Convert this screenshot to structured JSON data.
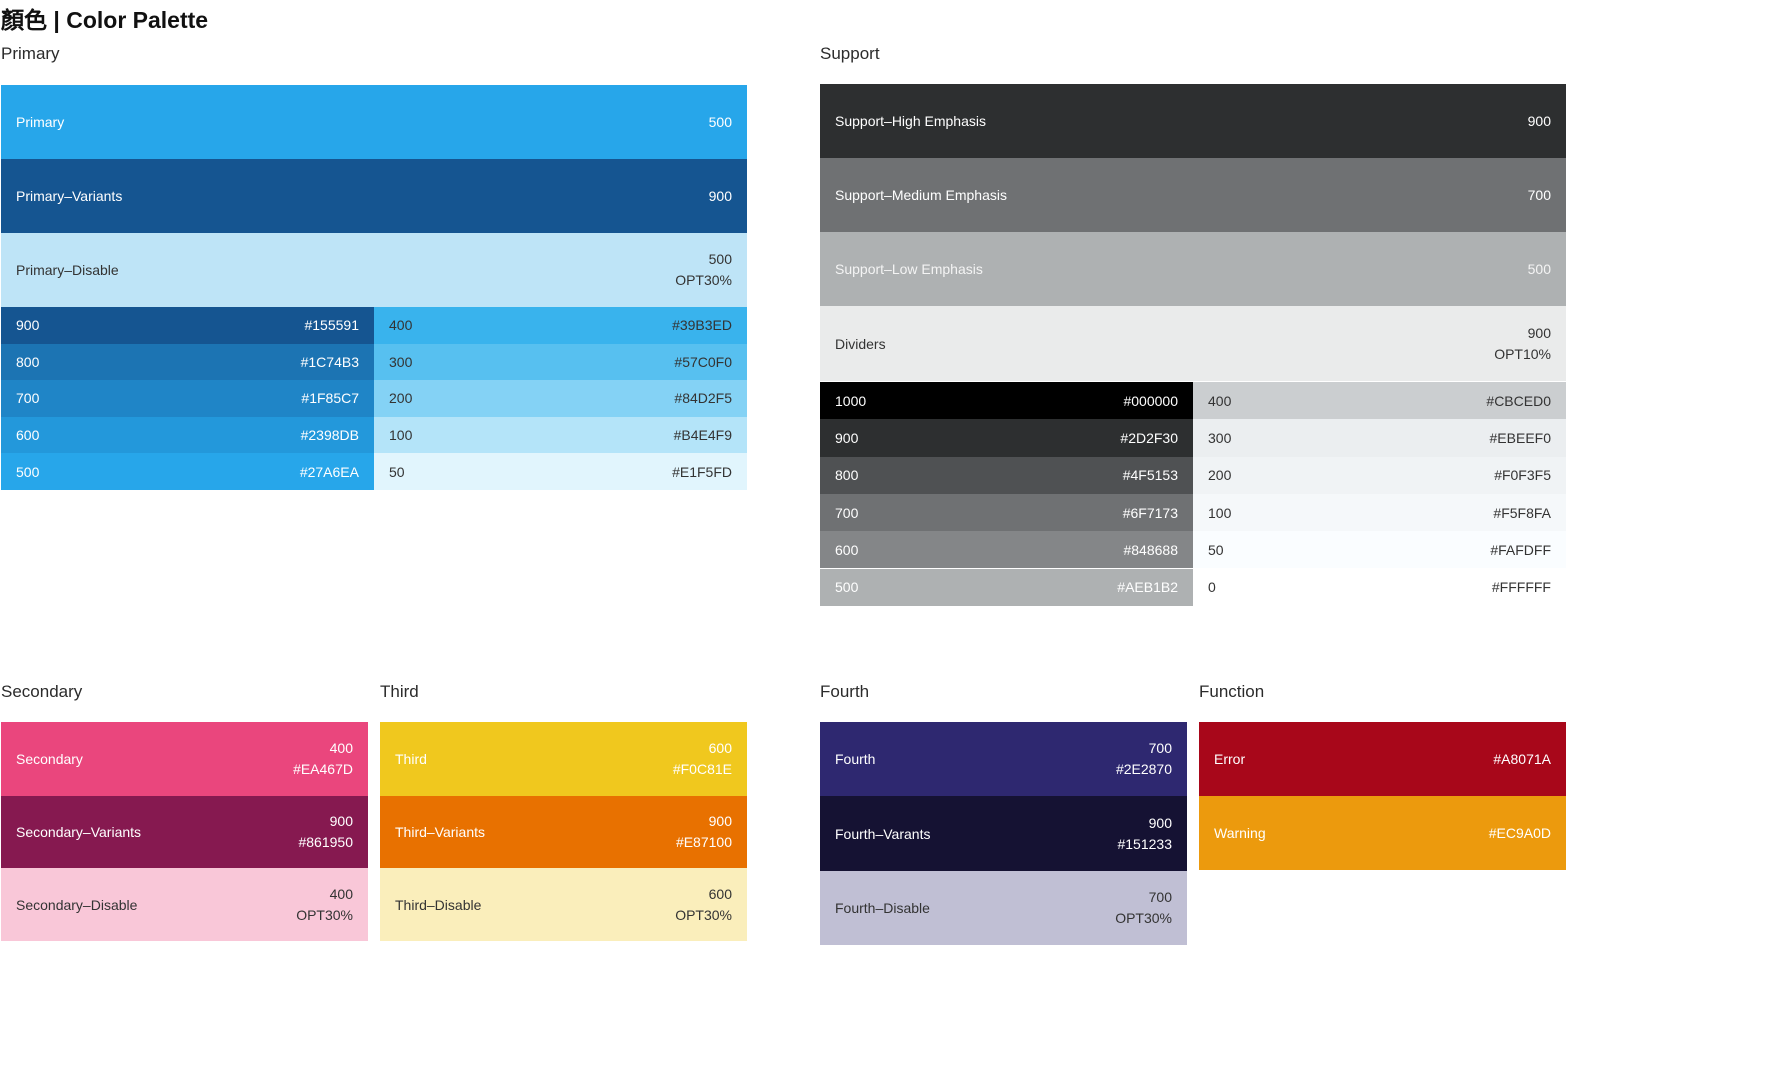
{
  "title": "顏色 | Color Palette",
  "primary": {
    "heading": "Primary",
    "big": [
      {
        "name": "Primary",
        "v1": "500",
        "v2": "",
        "color": "#27A6EA",
        "text": "#ffffff"
      },
      {
        "name": "Primary–Variants",
        "v1": "900",
        "v2": "",
        "color": "#155591",
        "text": "#ffffff"
      },
      {
        "name": "Primary–Disable",
        "v1": "500",
        "v2": "OPT30%",
        "color": "#BEE4F7",
        "text": "#333333"
      }
    ],
    "left": [
      {
        "level": "900",
        "hex": "#155591",
        "color": "#155591",
        "text": "#ffffff"
      },
      {
        "level": "800",
        "hex": "#1C74B3",
        "color": "#1C74B3",
        "text": "#ffffff"
      },
      {
        "level": "700",
        "hex": "#1F85C7",
        "color": "#1F85C7",
        "text": "#ffffff"
      },
      {
        "level": "600",
        "hex": "#2398DB",
        "color": "#2398DB",
        "text": "#ffffff"
      },
      {
        "level": "500",
        "hex": "#27A6EA",
        "color": "#27A6EA",
        "text": "#ffffff"
      }
    ],
    "right": [
      {
        "level": "400",
        "hex": "#39B3ED",
        "color": "#39B3ED",
        "text": "#333333"
      },
      {
        "level": "300",
        "hex": "#57C0F0",
        "color": "#57C0F0",
        "text": "#333333"
      },
      {
        "level": "200",
        "hex": "#84D2F5",
        "color": "#84D2F5",
        "text": "#333333"
      },
      {
        "level": "100",
        "hex": "#B4E4F9",
        "color": "#B4E4F9",
        "text": "#333333"
      },
      {
        "level": "50",
        "hex": "#E1F5FD",
        "color": "#E1F5FD",
        "text": "#333333"
      }
    ]
  },
  "support": {
    "heading": "Support",
    "big": [
      {
        "name": "Support–High Emphasis",
        "v1": "900",
        "v2": "",
        "color": "#2D2F30",
        "text": "#ffffff"
      },
      {
        "name": "Support–Medium Emphasis",
        "v1": "700",
        "v2": "",
        "color": "#6F7173",
        "text": "#ffffff"
      },
      {
        "name": "Support–Low Emphasis",
        "v1": "500",
        "v2": "",
        "color": "#AEB1B2",
        "text": "#f4f4f4"
      },
      {
        "name": "Dividers",
        "v1": "900",
        "v2": "OPT10%",
        "color": "#EAEBEB",
        "text": "#333333"
      }
    ],
    "left": [
      {
        "level": "1000",
        "hex": "#000000",
        "color": "#000000",
        "text": "#ffffff"
      },
      {
        "level": "900",
        "hex": "#2D2F30",
        "color": "#2D2F30",
        "text": "#ffffff"
      },
      {
        "level": "800",
        "hex": "#4F5153",
        "color": "#4F5153",
        "text": "#ffffff"
      },
      {
        "level": "700",
        "hex": "#6F7173",
        "color": "#6F7173",
        "text": "#ffffff"
      },
      {
        "level": "600",
        "hex": "#848688",
        "color": "#848688",
        "text": "#ffffff"
      },
      {
        "level": "500",
        "hex": "#AEB1B2",
        "color": "#AEB1B2",
        "text": "#ffffff"
      }
    ],
    "right": [
      {
        "level": "400",
        "hex": "#CBCED0",
        "color": "#CBCED0",
        "text": "#333333"
      },
      {
        "level": "300",
        "hex": "#EBEEF0",
        "color": "#EBEEF0",
        "text": "#333333"
      },
      {
        "level": "200",
        "hex": "#F0F3F5",
        "color": "#F0F3F5",
        "text": "#333333"
      },
      {
        "level": "100",
        "hex": "#F5F8FA",
        "color": "#F5F8FA",
        "text": "#333333"
      },
      {
        "level": "50",
        "hex": "#FAFDFF",
        "color": "#FAFDFF",
        "text": "#333333"
      },
      {
        "level": "0",
        "hex": "#FFFFFF",
        "color": "#FFFFFF",
        "text": "#333333"
      }
    ]
  },
  "secondary": {
    "heading": "Secondary",
    "items": [
      {
        "name": "Secondary",
        "v1": "400",
        "v2": "#EA467D",
        "color": "#EA467D",
        "text": "#ffffff"
      },
      {
        "name": "Secondary–Variants",
        "v1": "900",
        "v2": "#861950",
        "color": "#861950",
        "text": "#ffffff"
      },
      {
        "name": "Secondary–Disable",
        "v1": "400",
        "v2": "OPT30%",
        "color": "#F9C7D8",
        "text": "#333333"
      }
    ]
  },
  "third": {
    "heading": "Third",
    "items": [
      {
        "name": "Third",
        "v1": "600",
        "v2": "#F0C81E",
        "color": "#F0C81E",
        "text": "#ffffff"
      },
      {
        "name": "Third–Variants",
        "v1": "900",
        "v2": "#E87100",
        "color": "#E87100",
        "text": "#ffffff"
      },
      {
        "name": "Third–Disable",
        "v1": "600",
        "v2": "OPT30%",
        "color": "#FAEEBB",
        "text": "#333333"
      }
    ]
  },
  "fourth": {
    "heading": "Fourth",
    "items": [
      {
        "name": "Fourth",
        "v1": "700",
        "v2": "#2E2870",
        "color": "#2E2870",
        "text": "#ffffff"
      },
      {
        "name": "Fourth–Varants",
        "v1": "900",
        "v2": "#151233",
        "color": "#151233",
        "text": "#ffffff"
      },
      {
        "name": "Fourth–Disable",
        "v1": "700",
        "v2": "OPT30%",
        "color": "#C0BFD4",
        "text": "#333333"
      }
    ]
  },
  "function": {
    "heading": "Function",
    "items": [
      {
        "name": "Error",
        "v1": "#A8071A",
        "v2": "",
        "color": "#A8071A",
        "text": "#ffffff"
      },
      {
        "name": "Warning",
        "v1": "#EC9A0D",
        "v2": "",
        "color": "#EC9A0D",
        "text": "#ffffff"
      }
    ]
  }
}
